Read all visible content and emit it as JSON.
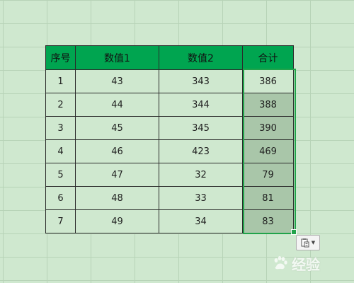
{
  "table": {
    "headers": [
      "序号",
      "数值1",
      "数值2",
      "合计"
    ],
    "rows": [
      [
        "1",
        "43",
        "343",
        "386"
      ],
      [
        "2",
        "44",
        "344",
        "388"
      ],
      [
        "3",
        "45",
        "345",
        "390"
      ],
      [
        "4",
        "46",
        "423",
        "469"
      ],
      [
        "5",
        "47",
        "32",
        "79"
      ],
      [
        "6",
        "48",
        "33",
        "81"
      ],
      [
        "7",
        "49",
        "34",
        "83"
      ]
    ]
  },
  "colors": {
    "sheet_background": "#cfe8cf",
    "header_fill": "#00a550",
    "selection_border": "#21a34a",
    "selected_cell_fill": "#a9c6a9"
  },
  "paste_options": {
    "icon": "paste-options-icon",
    "dropdown_icon": "chevron-down-icon"
  },
  "watermark": {
    "text": "经验",
    "logo": "baidu-paw-logo"
  }
}
